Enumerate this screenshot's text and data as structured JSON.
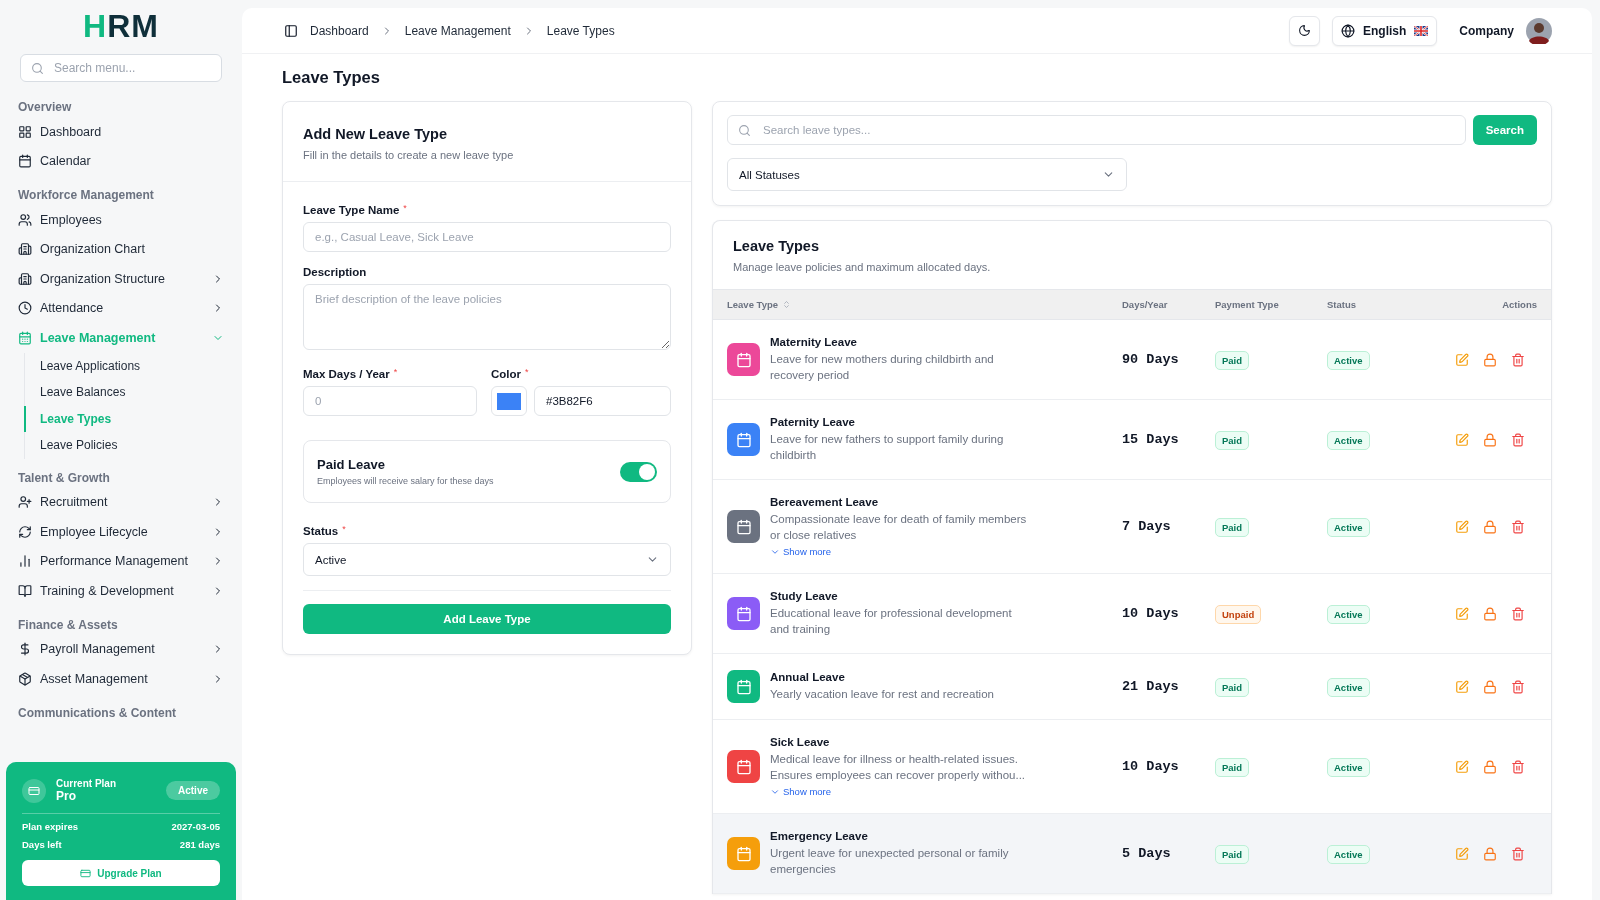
{
  "logo": {
    "accent": "H",
    "rest": "RM"
  },
  "sidebar": {
    "search_placeholder": "Search menu...",
    "groups": [
      {
        "title": "Overview",
        "items": [
          {
            "label": "Dashboard",
            "expandable": false,
            "selected": false
          },
          {
            "label": "Calendar",
            "expandable": false,
            "selected": false
          }
        ]
      },
      {
        "title": "Workforce Management",
        "items": [
          {
            "label": "Employees",
            "expandable": false,
            "selected": false
          },
          {
            "label": "Organization Chart",
            "expandable": false,
            "selected": false
          },
          {
            "label": "Organization Structure",
            "expandable": true,
            "expanded": false,
            "selected": false
          },
          {
            "label": "Attendance",
            "expandable": true,
            "expanded": false,
            "selected": false
          },
          {
            "label": "Leave Management",
            "expandable": true,
            "expanded": true,
            "selected": true,
            "children": [
              {
                "label": "Leave Applications",
                "selected": false
              },
              {
                "label": "Leave Balances",
                "selected": false
              },
              {
                "label": "Leave Types",
                "selected": true
              },
              {
                "label": "Leave Policies",
                "selected": false
              }
            ]
          }
        ]
      },
      {
        "title": "Talent & Growth",
        "items": [
          {
            "label": "Recruitment",
            "expandable": true,
            "expanded": false,
            "selected": false
          },
          {
            "label": "Employee Lifecycle",
            "expandable": true,
            "expanded": false,
            "selected": false
          },
          {
            "label": "Performance Management",
            "expandable": true,
            "expanded": false,
            "selected": false
          },
          {
            "label": "Training & Development",
            "expandable": true,
            "expanded": false,
            "selected": false
          }
        ]
      },
      {
        "title": "Finance & Assets",
        "items": [
          {
            "label": "Payroll Management",
            "expandable": true,
            "expanded": false,
            "selected": false
          },
          {
            "label": "Asset Management",
            "expandable": true,
            "expanded": false,
            "selected": false
          }
        ]
      },
      {
        "title": "Communications & Content"
      }
    ],
    "plan": {
      "title": "Current Plan",
      "name": "Pro",
      "badge": "Active",
      "rows": [
        {
          "label": "Plan expires",
          "value": "2027-03-05"
        },
        {
          "label": "Days left",
          "value": "281 days"
        }
      ],
      "button": "Upgrade Plan"
    }
  },
  "header": {
    "breadcrumbs": [
      "Dashboard",
      "Leave Management",
      "Leave Types"
    ],
    "language": "English",
    "user": "Company"
  },
  "page_title": "Leave Types",
  "form": {
    "title": "Add New Leave Type",
    "subtitle": "Fill in the details to create a new leave type",
    "name_label": {
      "text": "Leave Type Name",
      "mark": "*"
    },
    "name_placeholder": "e.g., Casual Leave, Sick Leave",
    "description_label": {
      "text": "Description"
    },
    "description_placeholder": "Brief description of the leave policies",
    "max_days_label": {
      "text": "Max Days / Year",
      "mark": "*"
    },
    "max_days_placeholder": "0",
    "color_label": {
      "text": "Color",
      "mark": "*"
    },
    "color": "#3b82f6",
    "color_value": "#3B82F6",
    "paid_title": "Paid Leave",
    "paid_hint": "Employees will receive salary for these days",
    "paid_on": true,
    "status_label": {
      "text": "Status",
      "mark": "*"
    },
    "status_value": "Active",
    "submit": "Add Leave Type"
  },
  "filters": {
    "search_placeholder": "Search leave types...",
    "search_button": "Search",
    "status_value": "All Statuses"
  },
  "table": {
    "title": "Leave Types",
    "subtitle": "Manage leave policies and maximum allocated days.",
    "columns": [
      {
        "label": "Leave Type",
        "sortable": true
      },
      {
        "label": "Days/Year"
      },
      {
        "label": "Payment Type"
      },
      {
        "label": "Status"
      },
      {
        "label": "Actions"
      }
    ],
    "rows": [
      {
        "color": "#ec4899",
        "name": "Maternity Leave",
        "description": "Leave for new mothers during childbirth and recovery period",
        "days": "90 Days",
        "payment": {
          "label": "Paid",
          "kind": "paid"
        },
        "status": "Active",
        "hovered": false
      },
      {
        "color": "#3b82f6",
        "name": "Paternity Leave",
        "description": "Leave for new fathers to support family during childbirth",
        "days": "15 Days",
        "payment": {
          "label": "Paid",
          "kind": "paid"
        },
        "status": "Active",
        "hovered": false
      },
      {
        "color": "#6b7280",
        "name": "Bereavement Leave",
        "description": "Compassionate leave for death of family members or close relatives",
        "show_more": "Show more",
        "days": "7 Days",
        "payment": {
          "label": "Paid",
          "kind": "paid"
        },
        "status": "Active",
        "hovered": false
      },
      {
        "color": "#8b5cf6",
        "name": "Study Leave",
        "description": "Educational leave for professional development and training",
        "days": "10 Days",
        "payment": {
          "label": "Unpaid",
          "kind": "unpaid"
        },
        "status": "Active",
        "hovered": false
      },
      {
        "color": "#10b981",
        "name": "Annual Leave",
        "description": "Yearly vacation leave for rest and recreation",
        "days": "21 Days",
        "payment": {
          "label": "Paid",
          "kind": "paid"
        },
        "status": "Active",
        "hovered": false
      },
      {
        "color": "#ef4444",
        "name": "Sick Leave",
        "description": "Medical leave for illness or health-related issues. Ensures employees can recover properly withou...",
        "show_more": "Show more",
        "days": "10 Days",
        "payment": {
          "label": "Paid",
          "kind": "paid"
        },
        "status": "Active",
        "hovered": false
      },
      {
        "color": "#f59e0b",
        "name": "Emergency Leave",
        "description": "Urgent leave for unexpected personal or family emergencies",
        "days": "5 Days",
        "payment": {
          "label": "Paid",
          "kind": "paid"
        },
        "status": "Active",
        "hovered": true
      }
    ]
  }
}
